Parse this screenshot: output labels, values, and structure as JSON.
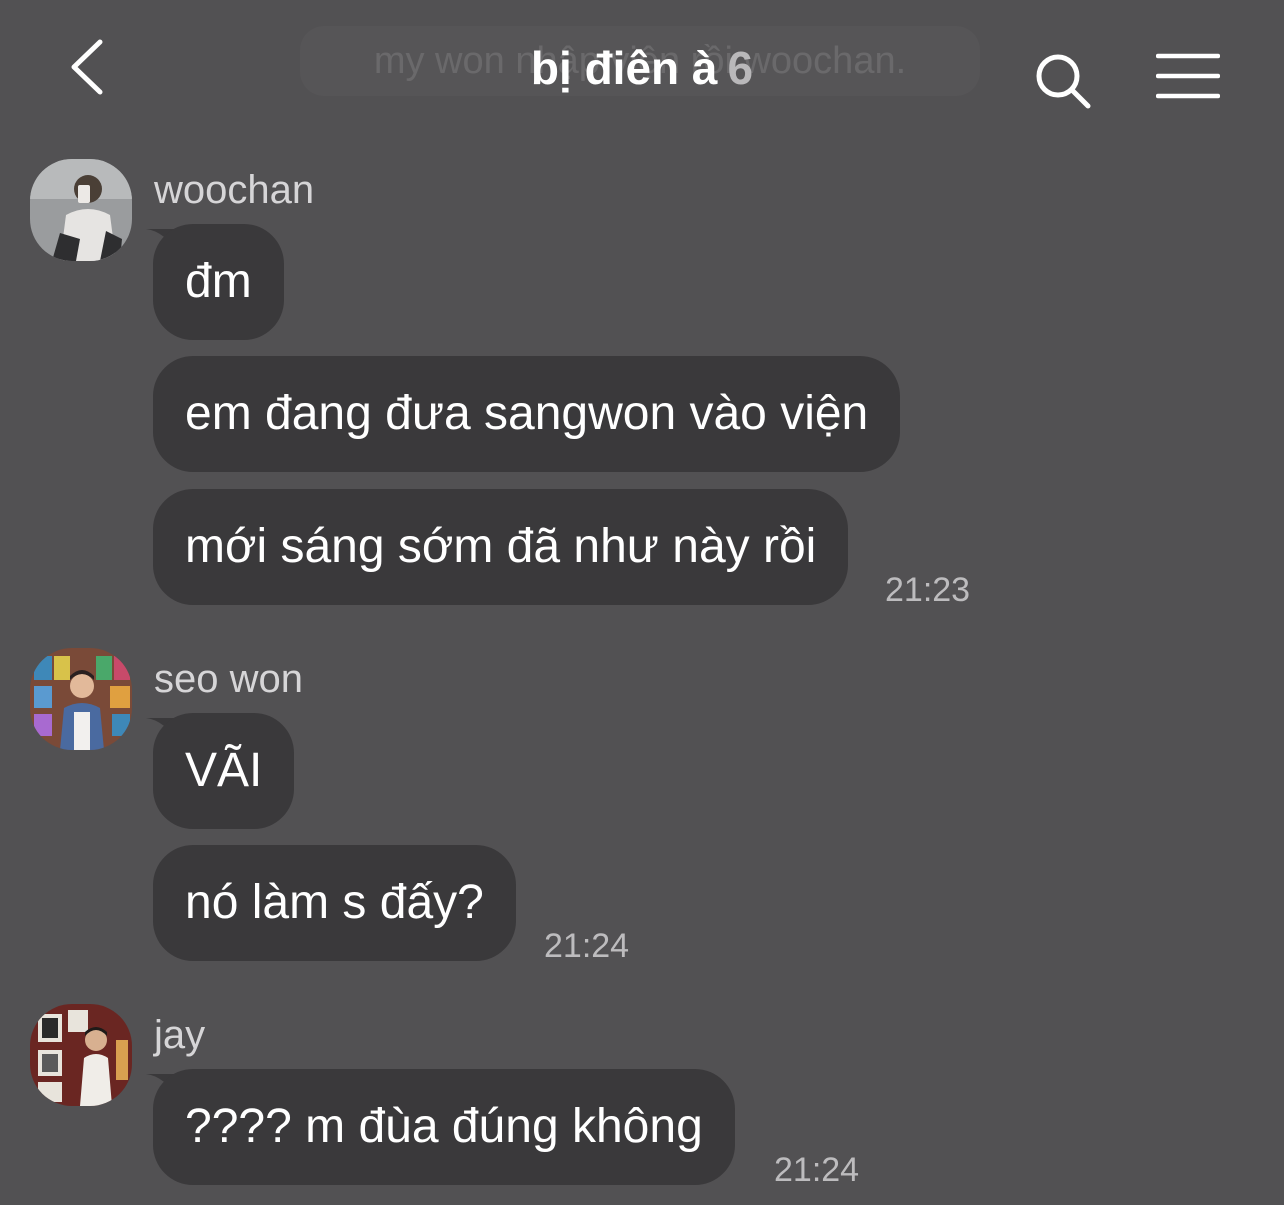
{
  "header": {
    "title": "bị điên à",
    "member_count": "6",
    "pinned_ghost_text": "my won nhập viện rồi woochan."
  },
  "messages": [
    {
      "sender": "woochan",
      "bubbles": [
        "đm",
        "em đang đưa sangwon vào viện",
        "mới sáng sớm đã như này rồi"
      ],
      "time": "21:23"
    },
    {
      "sender": "seo won",
      "bubbles": [
        "VÃI",
        "nó làm s đấy?"
      ],
      "time": "21:24"
    },
    {
      "sender": "jay",
      "bubbles": [
        "???? m đùa đúng không"
      ],
      "time": "21:24"
    }
  ],
  "colors": {
    "background": "#525153",
    "bubble": "#3a393b",
    "text": "#ffffff",
    "secondary_text": "#bdbcbe"
  },
  "icons": [
    "back-arrow-icon",
    "search-icon",
    "menu-icon"
  ]
}
